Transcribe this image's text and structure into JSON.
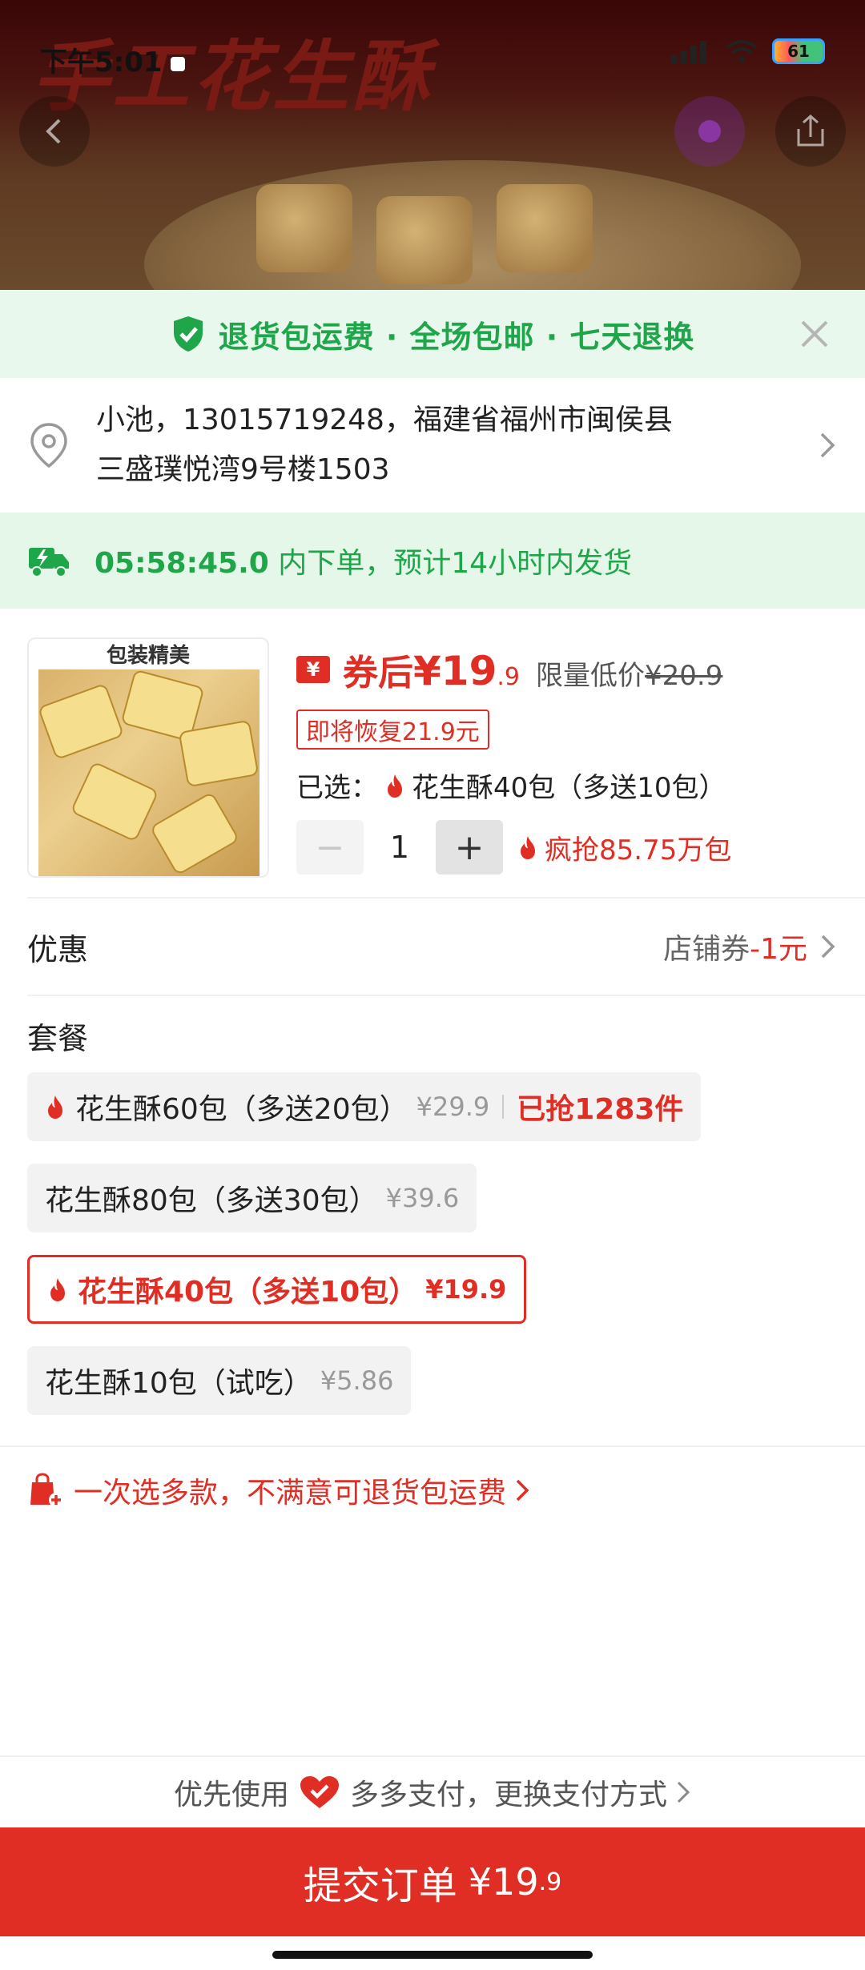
{
  "status_bar": {
    "time": "下午5:01",
    "battery": "61"
  },
  "hero": {
    "title": "手工花生酥"
  },
  "promo_bar": {
    "text": "退货包运费 · 全场包邮 · 七天退换"
  },
  "address": {
    "line1": "小池，13015719248，福建省福州市闽侯县",
    "line2": "三盛璞悦湾9号楼1503"
  },
  "shipping": {
    "timer": "05:58:45.0",
    "text": " 内下单，预计14小时内发货"
  },
  "product": {
    "thumb_label": "包装精美",
    "coupon_icon": "¥",
    "price_label": "券后",
    "price_symbol": "¥",
    "price_int": "19",
    "price_dec": ".9",
    "limit_label": "限量低价",
    "limit_price": "¥20.9",
    "restore_tag": "即将恢复21.9元",
    "selected_label": "已选：",
    "selected_value": "花生酥40包（多送10包）",
    "qty_minus": "−",
    "qty_value": "1",
    "qty_plus": "+",
    "hot_text": "疯抢85.75万包"
  },
  "discount": {
    "title": "优惠",
    "value_label": "店铺券",
    "value_amount": "-1元"
  },
  "package": {
    "title": "套餐",
    "options": [
      {
        "label": "花生酥60包（多送20包）",
        "price": "¥29.9",
        "sold": "已抢1283件",
        "hot": true,
        "selected": false
      },
      {
        "label": "花生酥80包（多送30包）",
        "price": "¥39.6",
        "sold": "",
        "hot": false,
        "selected": false
      },
      {
        "label": "花生酥40包（多送10包）",
        "price": "¥19.9",
        "sold": "",
        "hot": true,
        "selected": true
      },
      {
        "label": "花生酥10包（试吃）",
        "price": "¥5.86",
        "sold": "",
        "hot": false,
        "selected": false
      }
    ]
  },
  "multi_select": {
    "text": "一次选多款，不满意可退货包运费"
  },
  "payment": {
    "prefix": "优先使用",
    "text": "多多支付，更换支付方式"
  },
  "submit": {
    "label": "提交订单",
    "price_int": "¥19",
    "price_dec": ".9"
  },
  "colors": {
    "accent_red": "#e02e24",
    "accent_green": "#1fa64a"
  }
}
